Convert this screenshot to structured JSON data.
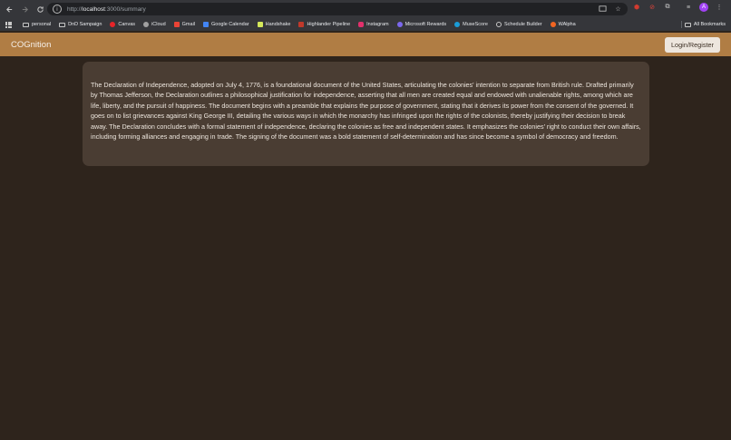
{
  "browser": {
    "url_scheme": "http://",
    "url_host": "localhost",
    "url_path": ":3000/summary",
    "bookmarks": [
      {
        "label": "personal",
        "icon": "folder-icon",
        "color": "#c8c8c8"
      },
      {
        "label": "DnD Sampaign",
        "icon": "folder-icon",
        "color": "#c8c8c8"
      },
      {
        "label": "Canvas",
        "icon": "canvas-icon",
        "color": "#e72429"
      },
      {
        "label": "iCloud",
        "icon": "apple-icon",
        "color": "#a0a0a0"
      },
      {
        "label": "Gmail",
        "icon": "gmail-icon",
        "color": "#ea4335"
      },
      {
        "label": "Google Calendar",
        "icon": "calendar-icon",
        "color": "#4285f4"
      },
      {
        "label": "Handshake",
        "icon": "handshake-icon",
        "color": "#d4e85a"
      },
      {
        "label": "Highlander Pipeline",
        "icon": "pipeline-icon",
        "color": "#c0392b"
      },
      {
        "label": "Instagram",
        "icon": "instagram-icon",
        "color": "#e1306c"
      },
      {
        "label": "Microsoft Rewards",
        "icon": "rewards-icon",
        "color": "#7b68ee"
      },
      {
        "label": "MuseScore",
        "icon": "musescore-icon",
        "color": "#1a9cd8"
      },
      {
        "label": "Schedule Builder",
        "icon": "globe-icon",
        "color": "#c8c8c8"
      },
      {
        "label": "WAlpha",
        "icon": "wolfram-icon",
        "color": "#f26522"
      }
    ],
    "all_bookmarks_label": "All Bookmarks",
    "profile_initial": "A"
  },
  "app": {
    "brand": "COGnition",
    "login_label": "Login/Register",
    "header_color": "#b07d44",
    "background_color": "#2e241c"
  },
  "summary": {
    "text": "The Declaration of Independence, adopted on July 4, 1776, is a foundational document of the United States, articulating the colonies' intention to separate from British rule. Drafted primarily by Thomas Jefferson, the Declaration outlines a philosophical justification for independence, asserting that all men are created equal and endowed with unalienable rights, among which are life, liberty, and the pursuit of happiness. The document begins with a preamble that explains the purpose of government, stating that it derives its power from the consent of the governed. It goes on to list grievances against King George III, detailing the various ways in which the monarchy has infringed upon the rights of the colonists, thereby justifying their decision to break away. The Declaration concludes with a formal statement of independence, declaring the colonies as free and independent states. It emphasizes the colonies' right to conduct their own affairs, including forming alliances and engaging in trade. The signing of the document was a bold statement of self-determination and has since become a symbol of democracy and freedom."
  }
}
